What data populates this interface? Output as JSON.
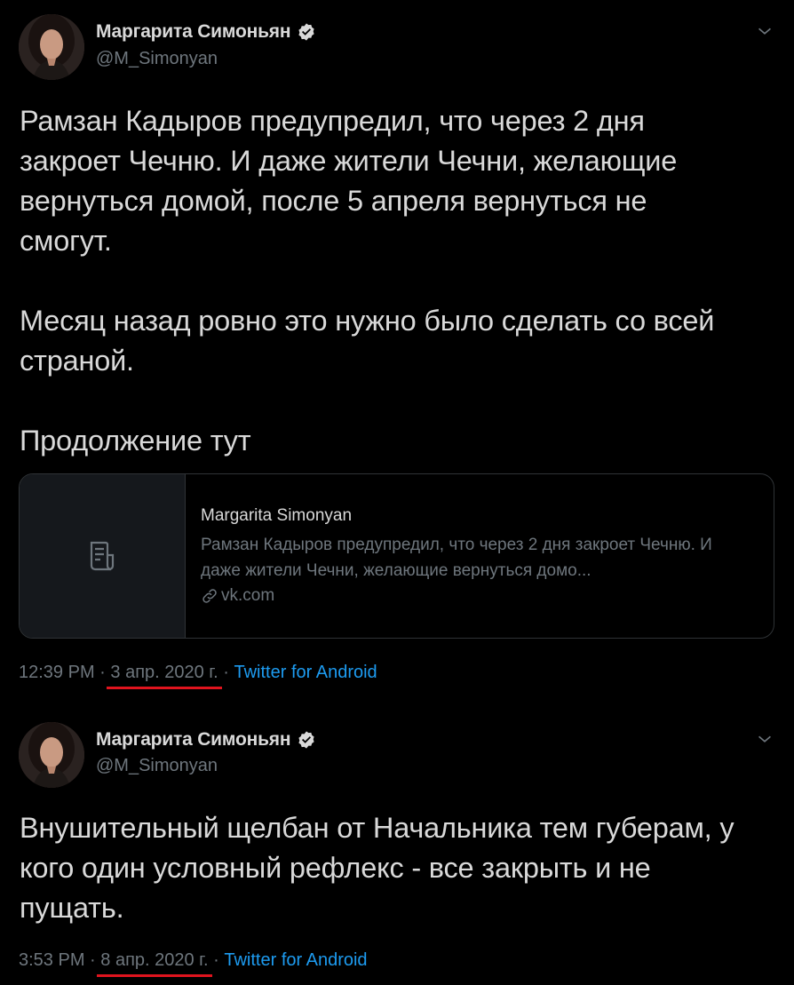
{
  "tweets": [
    {
      "author": {
        "display_name": "Маргарита Симоньян",
        "handle": "@M_Simonyan",
        "verified": true
      },
      "text": "Рамзан Кадыров предупредил, что через 2 дня\nзакроет Чечню. И даже жители Чечни, желающие\nвернуться домой, после 5 апреля вернуться не\nсмогут.\n\nМесяц назад ровно это нужно было сделать со всей\nстраной.\n\nПродолжение тут",
      "card": {
        "title": "Margarita Simonyan",
        "description": "Рамзан Кадыров предупредил, что через 2 дня закроет Чечню. И даже жители Чечни, желающие вернуться домо...",
        "domain": "vk.com",
        "thumb_icon": "document-icon",
        "link_icon": "link-icon"
      },
      "time": "12:39 PM",
      "separator": " · ",
      "date": "3 апр. 2020 г.",
      "source": "Twitter for Android",
      "date_highlighted": true
    },
    {
      "author": {
        "display_name": "Маргарита Симоньян",
        "handle": "@M_Simonyan",
        "verified": true
      },
      "text": "Внушительный щелбан от Начальника тем губерам, у\nкого один условный рефлекс - все закрыть и не\nпущать.",
      "time": "3:53 PM",
      "separator": " · ",
      "date": "8 апр. 2020 г.",
      "source": "Twitter for Android",
      "date_highlighted": true
    }
  ],
  "colors": {
    "background": "#000000",
    "text_primary": "#d9d9d9",
    "text_secondary": "#6e767d",
    "link": "#1d9bf0",
    "verified_badge": "#d9d9d9",
    "highlight_underline": "#e0141e",
    "card_border": "#2f3336"
  }
}
